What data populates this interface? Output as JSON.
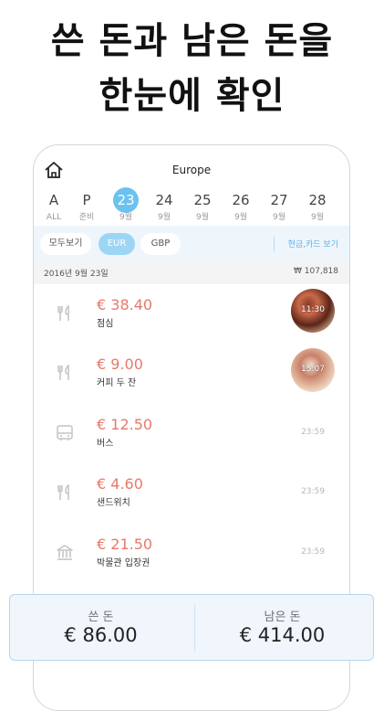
{
  "headline": {
    "line1": "쓴 돈과 남은 돈을",
    "line2": "한눈에 확인"
  },
  "topbar": {
    "home_icon": "home-icon",
    "title": "Europe"
  },
  "day_tabs": [
    {
      "num": "A",
      "sub": "ALL"
    },
    {
      "num": "P",
      "sub": "준비"
    },
    {
      "num": "23",
      "sub": "9월",
      "selected": true
    },
    {
      "num": "24",
      "sub": "9월"
    },
    {
      "num": "25",
      "sub": "9월"
    },
    {
      "num": "26",
      "sub": "9월"
    },
    {
      "num": "27",
      "sub": "9월"
    },
    {
      "num": "28",
      "sub": "9월"
    }
  ],
  "filters": {
    "chips": [
      {
        "label": "모두보기",
        "active": false
      },
      {
        "label": "EUR",
        "active": true
      },
      {
        "label": "GBP",
        "active": false
      }
    ],
    "cash_card": "현금,카드 보기"
  },
  "date_header": {
    "date": "2016년 9월 23일",
    "total": "₩ 107,818"
  },
  "expenses": [
    {
      "amount": "€ 38.40",
      "memo": "점심",
      "icon": "fork-knife-icon",
      "photo": true,
      "time": "11:30"
    },
    {
      "amount": "€ 9.00",
      "memo": "커피 두 잔",
      "icon": "fork-knife-icon",
      "photo": true,
      "time": "15:07"
    },
    {
      "amount": "€ 12.50",
      "memo": "버스",
      "icon": "bus-icon",
      "photo": false,
      "time": "23:59"
    },
    {
      "amount": "€ 4.60",
      "memo": "샌드위치",
      "icon": "fork-knife-icon",
      "photo": false,
      "time": "23:59"
    },
    {
      "amount": "€ 21.50",
      "memo": "박물관 입장권",
      "icon": "museum-icon",
      "photo": false,
      "time": "23:59"
    }
  ],
  "summary": {
    "spent_label": "쓴 돈",
    "spent_value": "€ 86.00",
    "remaining_label": "남은 돈",
    "remaining_value": "€ 414.00"
  },
  "colors": {
    "accent": "#6cc2ef",
    "amount": "#e8786a",
    "filter_bg": "#eef6fc",
    "summary_border": "#b5d6ee"
  }
}
